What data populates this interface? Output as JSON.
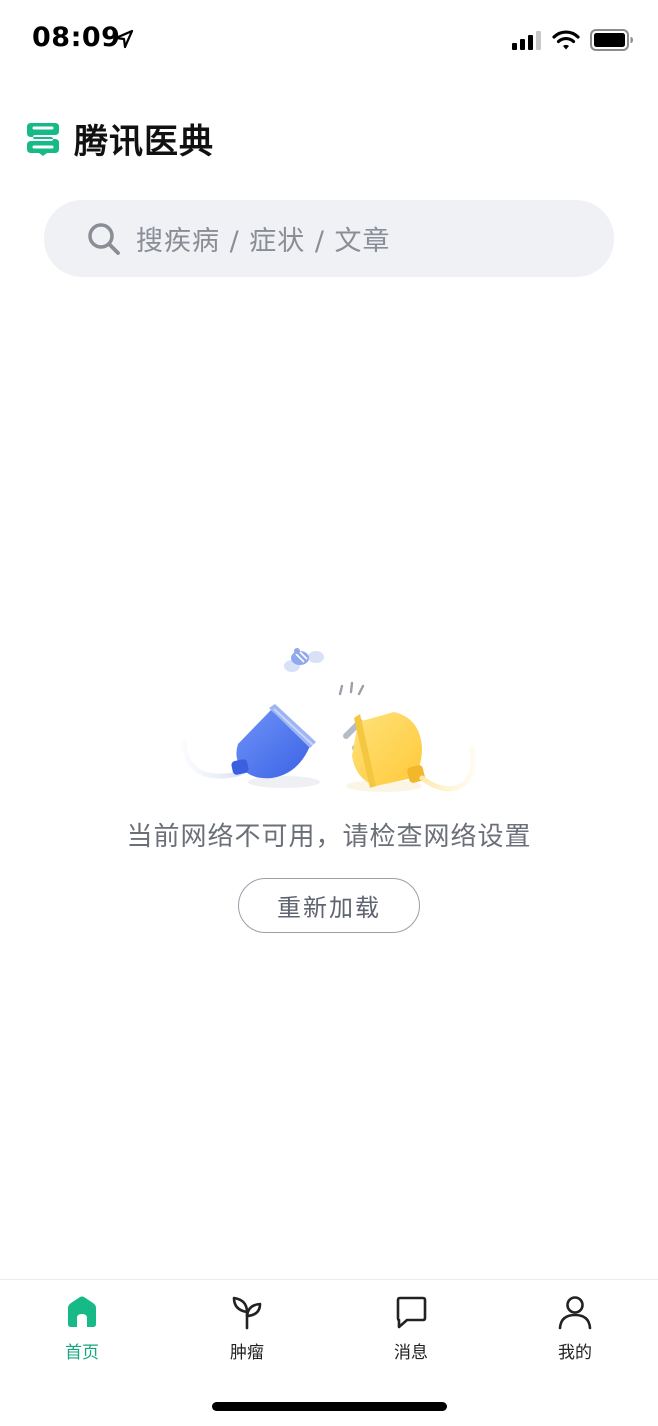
{
  "status_bar": {
    "time": "08:09",
    "icons": [
      "location-arrow-icon",
      "cellular-signal-icon",
      "wifi-icon",
      "battery-icon"
    ]
  },
  "app": {
    "title": "腾讯医典",
    "brand_color": "#17b987"
  },
  "search": {
    "placeholder": "搜疾病 / 症状 / 文章",
    "icon": "search-icon"
  },
  "empty_state": {
    "message": "当前网络不可用，请检查网络设置",
    "reload_label": "重新加载",
    "illustration": "unplugged-plug-and-socket"
  },
  "tabs": [
    {
      "label": "首页",
      "icon": "home-icon",
      "active": true
    },
    {
      "label": "肿瘤",
      "icon": "sprout-icon",
      "active": false
    },
    {
      "label": "消息",
      "icon": "chat-bubble-icon",
      "active": false
    },
    {
      "label": "我的",
      "icon": "person-icon",
      "active": false
    }
  ],
  "colors": {
    "accent": "#17a57d",
    "socket_blue": "#4f7cf2",
    "plug_yellow": "#ffd54f",
    "search_bg": "#f0f1f5"
  }
}
